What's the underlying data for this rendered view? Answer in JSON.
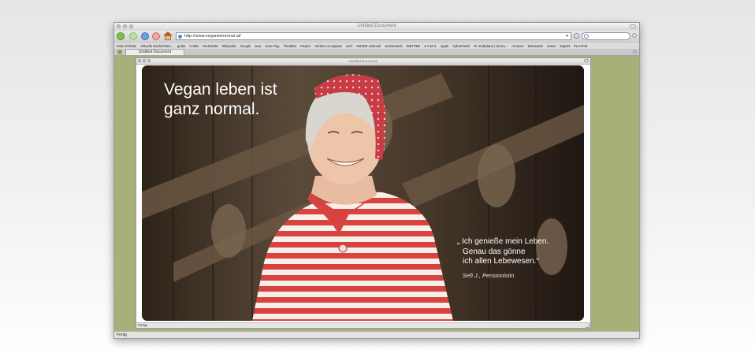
{
  "window": {
    "title": "Untitled Document"
  },
  "toolbar": {
    "url": "http://www.veganistnormal.at/",
    "icons": [
      "back-icon",
      "forward-icon",
      "reload-icon",
      "stop-icon",
      "home-icon",
      "search-icon"
    ]
  },
  "bookmarks": [
    "Erste Schritte",
    "Aktuelle Nachrichten...",
    "gmbs",
    "Corbis",
    "MAGNUM",
    "Wikipedia",
    "Google",
    "wow",
    "wow-Flug",
    "ThinkBot",
    "Pexpro",
    "Veritas et Aequitas",
    "LEO",
    "INDIDE webmail",
    "versiontrack",
    "WETTER",
    "Z A M G",
    "Apple",
    "CyberPatrol",
    "Rc Kalkulator | Sierra...",
    "Amazon",
    "bekannteh",
    "essen",
    "Map24",
    "PLAY.FM"
  ],
  "tabs": [
    {
      "label": "Untitled Document"
    }
  ],
  "inner_window": {
    "title": "Untitled Document",
    "status": "Fertig"
  },
  "page": {
    "headline_line1": "Vegan leben ist",
    "headline_line2": "ganz normal.",
    "quote_line1": "„ Ich genieße mein Leben.",
    "quote_line2": "Genau das gönne",
    "quote_line3": "ich allen Lebewesen.“",
    "attribution": "Sefi J., Pensionistin"
  },
  "status": {
    "text": "Fertig"
  },
  "colors": {
    "page_background": "#a8b07a",
    "shirt_red": "#d8433f",
    "headscarf_red": "#c83c46"
  }
}
